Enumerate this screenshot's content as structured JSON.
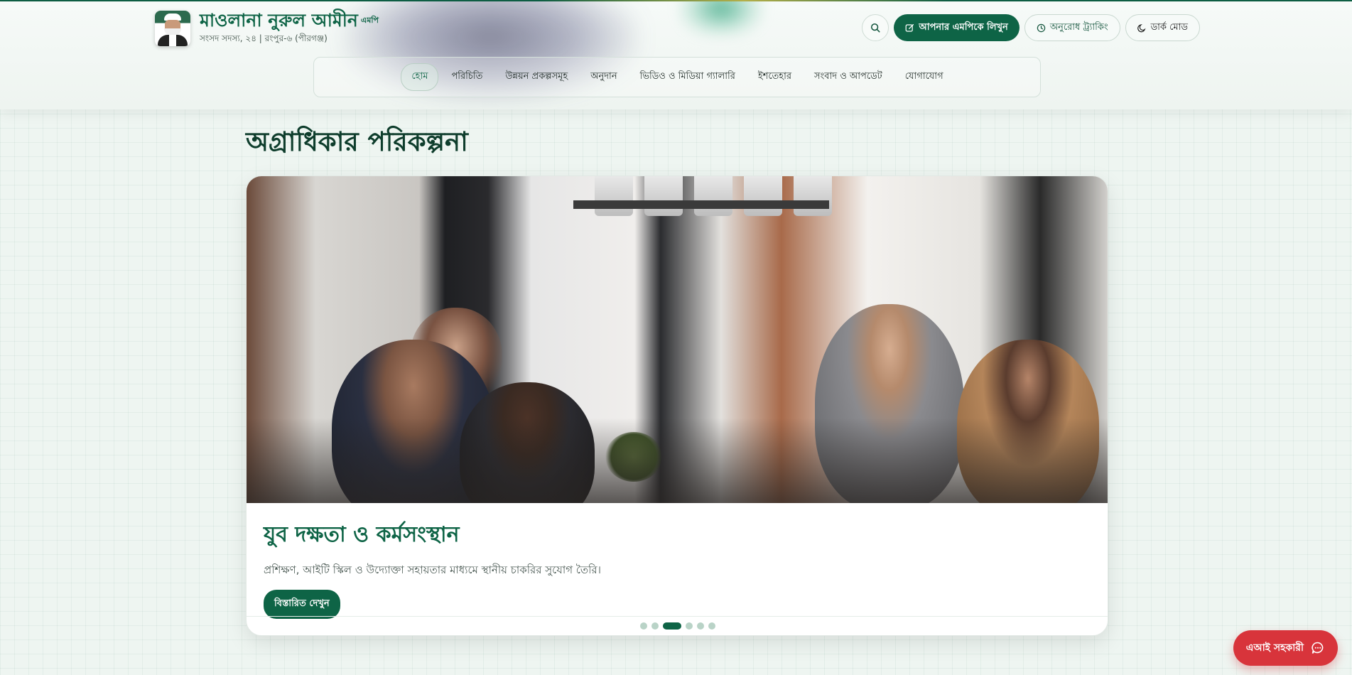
{
  "header": {
    "brand": {
      "name": "মাওলানা নুরুল আমীন",
      "superscript": "এমপি",
      "subtitle": "সংসদ সদস্য, ২৪ | রংপুর-৬ (পীরগঞ্জ)"
    },
    "actions": {
      "write_label": "আপনার এমপিকে লিখুন",
      "track_label": "অনুরোধ ট্র্যাকিং",
      "dark_label": "ডার্ক মোড"
    },
    "icons": [
      "search-icon",
      "edit-icon",
      "clock-icon",
      "moon-icon"
    ]
  },
  "nav": {
    "items": [
      {
        "label": "হোম",
        "active": true
      },
      {
        "label": "পরিচিতি"
      },
      {
        "label": "উন্নয়ন প্রকল্পসমূহ"
      },
      {
        "label": "অনুদান"
      },
      {
        "label": "ভিডিও ও মিডিয়া গ্যালারি"
      },
      {
        "label": "ইশতেহার"
      },
      {
        "label": "সংবাদ ও আপডেট"
      },
      {
        "label": "যোগাযোগ"
      }
    ]
  },
  "main": {
    "section_title": "অগ্রাধিকার পরিকল্পনা",
    "slide": {
      "title": "যুব দক্ষতা ও কর্মসংস্থান",
      "description": "প্রশিক্ষণ, আইটি স্কিল ও উদ্যোক্তা সহায়তার মাধ্যমে স্থানীয় চাকরির সুযোগ তৈরি।",
      "cta_label": "বিস্তারিত দেখুন"
    },
    "carousel": {
      "total": 6,
      "active_index": 2
    }
  },
  "fab": {
    "label": "এআই সহকারী",
    "icon": "chat-icon"
  },
  "colors": {
    "primary": "#0e6446",
    "accent_red": "#d8343b",
    "dot_inactive": "#b9d3c7"
  }
}
